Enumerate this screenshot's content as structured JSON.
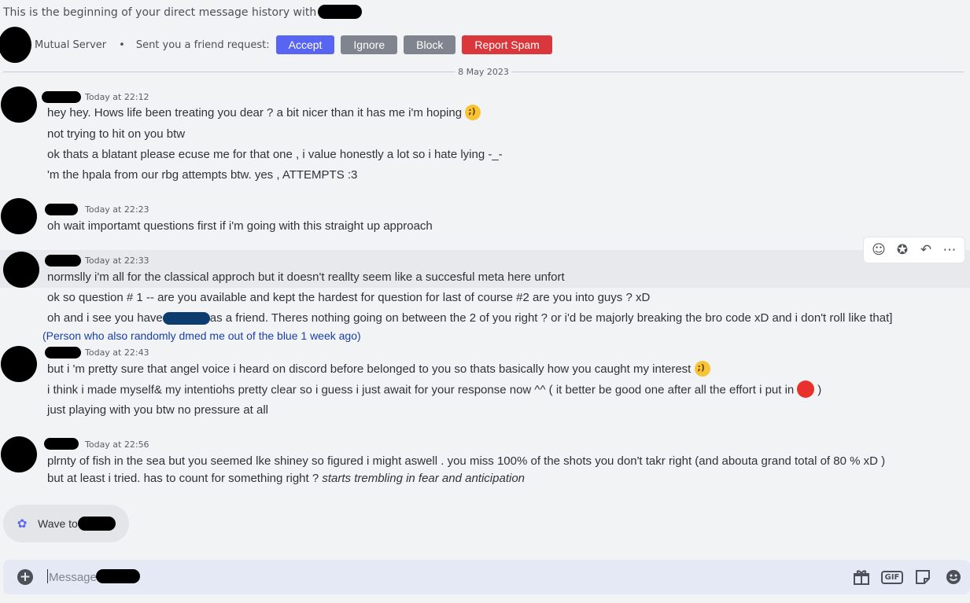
{
  "intro": {
    "text": "This is the beginning of your direct message history with"
  },
  "friend_request": {
    "mutual_label": "Mutual Server",
    "separator": "•",
    "request_label": "Sent you a friend request:",
    "accept_label": "Accept",
    "ignore_label": "Ignore",
    "block_label": "Block",
    "spam_label": "Report Spam"
  },
  "divider": {
    "date": "8 May 2023"
  },
  "groups": [
    {
      "timestamp": "Today at 22:12",
      "lines": [
        "hey hey. Hows life been treating you dear ? a bit nicer than it has me i'm hoping",
        "not trying to hit on you btw",
        "ok thats a blatant please ecuse me for that one , i value honestly a lot so i hate lying  -_-",
        "'m the hpala from our rbg attempts btw. yes , ATTEMPTS :3"
      ]
    },
    {
      "timestamp": "Today at 22:23",
      "lines": [
        "oh wait importamt questions first if i'm going with this straight up approach"
      ]
    },
    {
      "timestamp": "Today at 22:33",
      "lines": [
        "normslly i'm all for the classical approch but it    doesn't reallty seem      like a succesful meta here unfort",
        "ok so question # 1 -- are you available  and kept the hardest for question for last of course        #2 are you into guys ? xD",
        "oh and i see you have",
        "as a friend. Theres nothing going on between the 2 of you right ? or i'd be majorly breaking the bro code xD and i don't roll like that]"
      ],
      "note": "(Person who also randomly dmed me out of the blue 1 week ago)"
    },
    {
      "timestamp": "Today at 22:43",
      "lines": [
        "but i 'm pretty sure that angel voice i heard on discord before belonged to you so thats basically how you caught my interest",
        "i think i made myself& my intentiohs pretty clear so i guess i just await for your response now      ^^  ( it better be good one after all the effort i put in",
        ")",
        "just playing with you btw no pressure at all"
      ]
    },
    {
      "timestamp": "Today at 22:56",
      "lines": [
        "plrnty of fish in the sea but you seemed lke shiney so  figured i might aswell  . you miss 100% of the shots you don't takr right (and abouta  grand total of 80 % xD )",
        "but at least i  tried. has to count for something right  ?",
        "starts trembling in fear and anticipation"
      ]
    }
  ],
  "wave": {
    "label": "Wave to"
  },
  "composer": {
    "placeholder": "Message"
  },
  "icons": {
    "toolbar": [
      "add-reaction-icon",
      "super-reaction-icon",
      "reply-icon",
      "more-icon"
    ],
    "composer": [
      "plus-icon",
      "gift-icon",
      "gif-icon",
      "sticker-icon",
      "emoji-icon"
    ]
  },
  "colors": {
    "accent": "#5865f2",
    "danger": "#da373c",
    "secondary": "#80848e",
    "background": "#f2f3f5"
  }
}
